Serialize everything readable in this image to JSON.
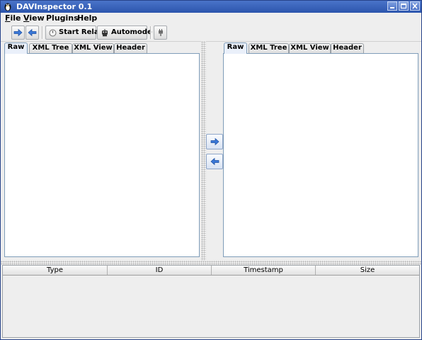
{
  "window": {
    "title": "DAVInspector 0.1"
  },
  "menu": {
    "file": {
      "first": "F",
      "rest": "ile"
    },
    "view": {
      "first": "V",
      "rest": "iew"
    },
    "plugins": {
      "first": "",
      "rest": "Plugins"
    },
    "help": {
      "first": "",
      "rest": "Help"
    }
  },
  "toolbar": {
    "start_relay_label": "Start Relay",
    "automode_label": "Automode"
  },
  "left_panel": {
    "tabs": [
      "Raw",
      "XML Tree",
      "XML View",
      "Header"
    ],
    "active_tab": "Raw",
    "content": ""
  },
  "right_panel": {
    "tabs": [
      "Raw",
      "XML Tree",
      "XML View",
      "Header"
    ],
    "active_tab": "Raw",
    "content": ""
  },
  "table": {
    "columns": [
      "Type",
      "ID",
      "Timestamp",
      "Size"
    ],
    "rows": []
  },
  "colors": {
    "titlebar": "#2c55ad",
    "arrow_blue": "#3a78d8",
    "editor_border": "#7f9db9"
  },
  "icons": {
    "forward": "arrow-right-icon",
    "back": "arrow-left-icon",
    "start_relay": "power-icon",
    "automode": "robot-icon",
    "plugin": "plug-icon"
  }
}
